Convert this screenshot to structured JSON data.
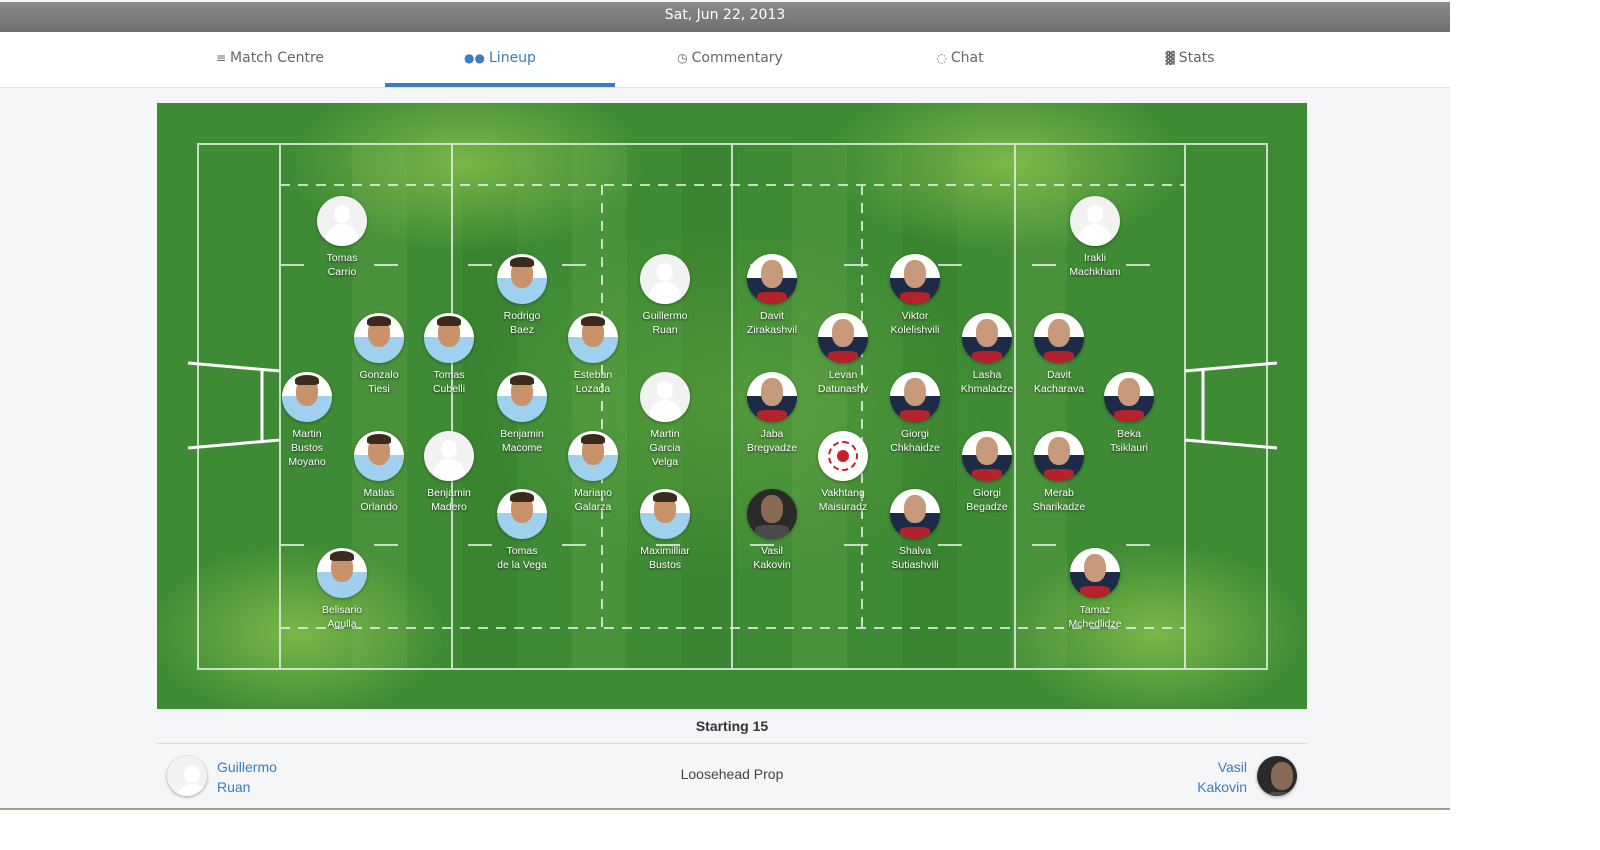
{
  "date": "Sat, Jun 22, 2013",
  "tabs": [
    {
      "label": "Match Centre",
      "icon": "rss-icon",
      "glyph": "≡",
      "active": false
    },
    {
      "label": "Lineup",
      "icon": "users-icon",
      "glyph": "●●",
      "active": true
    },
    {
      "label": "Commentary",
      "icon": "clock-icon",
      "glyph": "◷",
      "active": false
    },
    {
      "label": "Chat",
      "icon": "chat-icon",
      "glyph": "◌",
      "active": false
    },
    {
      "label": "Stats",
      "icon": "bar-chart-icon",
      "glyph": "▓",
      "active": false
    }
  ],
  "colors": {
    "accent": "#3a7cc0",
    "pitch": "#3f8a35",
    "date_bar": "#7d7d7d"
  },
  "players": [
    {
      "first": "Tomas",
      "last": "Carrio",
      "team": "argentina",
      "avatar": "blank"
    },
    {
      "first": "Rodrigo",
      "last": "Baez",
      "team": "argentina",
      "avatar": "arg"
    },
    {
      "first": "Guillermo",
      "last": "Ruan",
      "team": "argentina",
      "avatar": "blank"
    },
    {
      "first": "Gonzalo",
      "last": "Tiesi",
      "team": "argentina",
      "avatar": "arg"
    },
    {
      "first": "Tomas",
      "last": "Cubelli",
      "team": "argentina",
      "avatar": "arg"
    },
    {
      "first": "Esteban",
      "last": "Lozada",
      "team": "argentina",
      "avatar": "arg"
    },
    {
      "first": "Martin",
      "last": "Bustos",
      "extra": "Moyano",
      "team": "argentina",
      "avatar": "arg"
    },
    {
      "first": "Benjamin",
      "last": "Macome",
      "team": "argentina",
      "avatar": "arg"
    },
    {
      "first": "Martin",
      "last": "Garcia",
      "extra": "Velga",
      "team": "argentina",
      "avatar": "blank"
    },
    {
      "first": "Matias",
      "last": "Orlando",
      "team": "argentina",
      "avatar": "arg"
    },
    {
      "first": "Benjamin",
      "last": "Madero",
      "team": "argentina",
      "avatar": "blank"
    },
    {
      "first": "Mariano",
      "last": "Galarza",
      "team": "argentina",
      "avatar": "arg"
    },
    {
      "first": "Tomas",
      "last": "de la Vega",
      "team": "argentina",
      "avatar": "arg"
    },
    {
      "first": "Maximilliar",
      "last": "Bustos",
      "team": "argentina",
      "avatar": "arg"
    },
    {
      "first": "Belisario",
      "last": "Agulla",
      "team": "argentina",
      "avatar": "arg"
    },
    {
      "first": "Irakli",
      "last": "Machkhanı",
      "team": "georgia",
      "avatar": "blank"
    },
    {
      "first": "Davit",
      "last": "Zirakashvil",
      "team": "georgia",
      "avatar": "geo"
    },
    {
      "first": "Viktor",
      "last": "Kolelishvili",
      "team": "georgia",
      "avatar": "geo"
    },
    {
      "first": "Levan",
      "last": "Datunashv",
      "team": "georgia",
      "avatar": "geo"
    },
    {
      "first": "Lasha",
      "last": "Khmaladze",
      "team": "georgia",
      "avatar": "geo"
    },
    {
      "first": "Davit",
      "last": "Kacharava",
      "team": "georgia",
      "avatar": "geo"
    },
    {
      "first": "Jaba",
      "last": "Bregvadze",
      "team": "georgia",
      "avatar": "geo"
    },
    {
      "first": "Giorgi",
      "last": "Chkhaidze",
      "team": "georgia",
      "avatar": "geo"
    },
    {
      "first": "Beka",
      "last": "Tsiklauri",
      "team": "georgia",
      "avatar": "geo"
    },
    {
      "first": "Vakhtang",
      "last": "Maisuradz",
      "team": "georgia",
      "avatar": "crest"
    },
    {
      "first": "Giorgi",
      "last": "Begadze",
      "team": "georgia",
      "avatar": "geo"
    },
    {
      "first": "Merab",
      "last": "Sharikadze",
      "team": "georgia",
      "avatar": "geo"
    },
    {
      "first": "Vasil",
      "last": "Kakovin",
      "team": "georgia",
      "avatar": "dark"
    },
    {
      "first": "Shalva",
      "last": "Sutiashvili",
      "team": "georgia",
      "avatar": "geo"
    },
    {
      "first": "Tamaz",
      "last": "Mchedlidzе",
      "team": "georgia",
      "avatar": "geo"
    }
  ],
  "section_title": "Starting 15",
  "position_row": {
    "left_first": "Guillermo",
    "left_last": "Ruan",
    "position": "Loosehead Prop",
    "right_first": "Vasil",
    "right_last": "Kakovin"
  }
}
